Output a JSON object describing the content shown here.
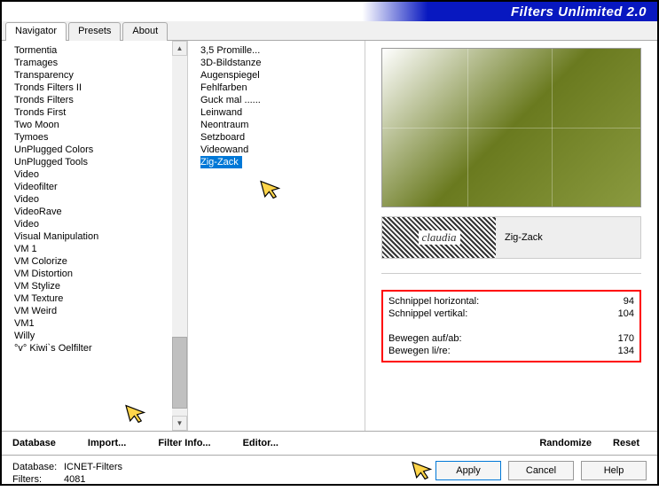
{
  "header": {
    "title": "Filters Unlimited 2.0"
  },
  "tabs": {
    "navigator": "Navigator",
    "presets": "Presets",
    "about": "About"
  },
  "categories": [
    "Tormentia",
    "Tramages",
    "Transparency",
    "Tronds Filters II",
    "Tronds Filters",
    "Tronds First",
    "Two Moon",
    "Tymoes",
    "UnPlugged Colors",
    "UnPlugged Tools",
    "Video",
    "Videofilter",
    "Video",
    "VideoRave",
    "Video",
    "Visual Manipulation",
    "VM 1",
    "VM Colorize",
    "VM Distortion",
    "VM Stylize",
    "VM Texture",
    "VM Weird",
    "VM1",
    "Willy",
    "°v° Kiwi`s Oelfilter"
  ],
  "filters": [
    "3,5 Promille...",
    "3D-Bildstanze",
    "Augenspiegel",
    "Fehlfarben",
    "Guck mal ......",
    "Leinwand",
    "Neontraum",
    "Setzboard",
    "Videowand",
    "Zig-Zack"
  ],
  "selected_filter_index": 9,
  "preview_label": {
    "logo": "claudia",
    "name": "Zig-Zack"
  },
  "params": {
    "p1_label": "Schnippel horizontal:",
    "p1_value": "94",
    "p2_label": "Schnippel vertikal:",
    "p2_value": "104",
    "p3_label": "Bewegen auf/ab:",
    "p3_value": "170",
    "p4_label": "Bewegen li/re:",
    "p4_value": "134"
  },
  "toolbar": {
    "database": "Database",
    "import": "Import...",
    "filter_info": "Filter Info...",
    "editor": "Editor...",
    "randomize": "Randomize",
    "reset": "Reset"
  },
  "footer": {
    "db_label": "Database:",
    "db_value": "ICNET-Filters",
    "filters_label": "Filters:",
    "filters_value": "4081",
    "apply": "Apply",
    "cancel": "Cancel",
    "help": "Help"
  }
}
